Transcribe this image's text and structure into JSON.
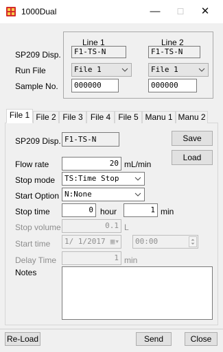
{
  "window": {
    "title": "1000Dual",
    "minimize": "—",
    "maximize": "☐",
    "close": "✕"
  },
  "header": {
    "line1_label": "Line 1",
    "line2_label": "Line 2",
    "sp209_label": "SP209 Disp.",
    "run_file_label": "Run File",
    "sample_no_label": "Sample No.",
    "line1": {
      "sp209": "F1-TS-N",
      "run_file": "File 1",
      "sample_no": "000000"
    },
    "line2": {
      "sp209": "F1-TS-N",
      "run_file": "File 1",
      "sample_no": "000000"
    }
  },
  "tabs": [
    "File 1",
    "File 2",
    "File 3",
    "File 4",
    "File 5",
    "Manu 1",
    "Manu 2"
  ],
  "active_tab": "File 1",
  "file_tab": {
    "sp209_label": "SP209 Disp.",
    "sp209_value": "F1-TS-N",
    "save_label": "Save",
    "load_label": "Load",
    "flow_rate_label": "Flow rate",
    "flow_rate_value": "20",
    "flow_rate_unit": "mL/min",
    "stop_mode_label": "Stop mode",
    "stop_mode_value": "TS:Time Stop",
    "start_option_label": "Start Option",
    "start_option_value": "N:None",
    "stop_time_label": "Stop time",
    "stop_time_hours": "0",
    "stop_time_hour_unit": "hour",
    "stop_time_minutes": "1",
    "stop_time_min_unit": "min",
    "stop_volume_label": "Stop volume",
    "stop_volume_value": "0.1",
    "stop_volume_unit": "L",
    "start_time_label": "Start time",
    "start_time_date": "1/ 1/2017",
    "start_time_clock": "00:00",
    "delay_time_label": "Delay Time",
    "delay_time_value": "1",
    "delay_time_unit": "min",
    "notes_label": "Notes",
    "notes_value": ""
  },
  "footer": {
    "reload_label": "Re-Load",
    "send_label": "Send",
    "close_label": "Close"
  },
  "colors": {
    "window_bg": "#f0f0f0",
    "field_bg": "#ffffff",
    "disabled_text": "#8d8d8d",
    "icon_red": "#d42a2a"
  }
}
